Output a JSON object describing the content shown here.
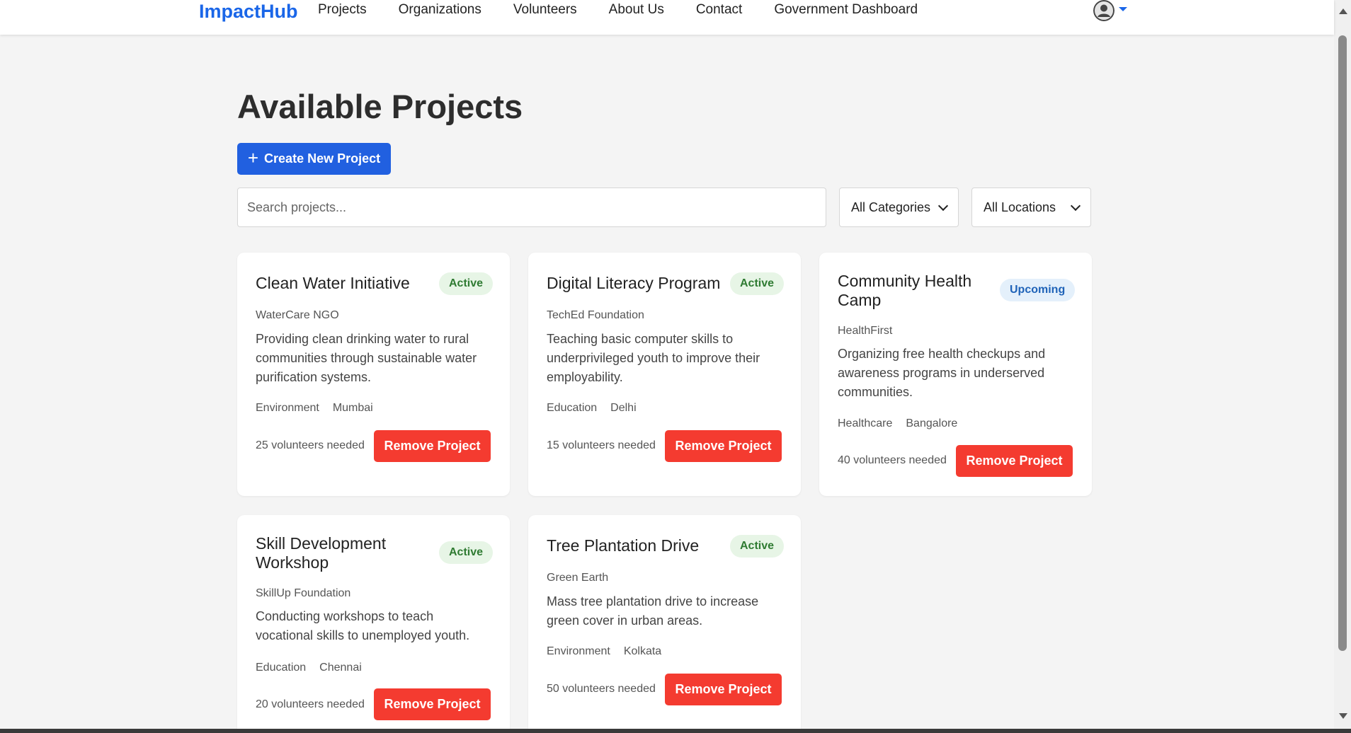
{
  "nav": {
    "brand": "ImpactHub",
    "links": [
      "Projects",
      "Organizations",
      "Volunteers",
      "About Us",
      "Contact",
      "Government Dashboard"
    ],
    "user_icon": "user-circle-icon"
  },
  "page": {
    "title": "Available Projects",
    "create_button": "Create New Project",
    "search_placeholder": "Search projects...",
    "category_filter": "All Categories",
    "location_filter": "All Locations"
  },
  "colors": {
    "brand": "#1a66e8",
    "primary_button": "#2160e0",
    "danger_button": "#f43b30",
    "active_badge_bg": "#e7f5e6",
    "upcoming_badge_bg": "#e4f0fb"
  },
  "projects": [
    {
      "title": "Clean Water Initiative",
      "status": "Active",
      "org": "WaterCare NGO",
      "description": "Providing clean drinking water to rural communities through sustainable water purification systems.",
      "category": "Environment",
      "location": "Mumbai",
      "volunteers": "25 volunteers needed",
      "action": "Remove Project"
    },
    {
      "title": "Digital Literacy Program",
      "status": "Active",
      "org": "TechEd Foundation",
      "description": "Teaching basic computer skills to underprivileged youth to improve their employability.",
      "category": "Education",
      "location": "Delhi",
      "volunteers": "15 volunteers needed",
      "action": "Remove Project"
    },
    {
      "title": "Community Health Camp",
      "status": "Upcoming",
      "org": "HealthFirst",
      "description": "Organizing free health checkups and awareness programs in underserved communities.",
      "category": "Healthcare",
      "location": "Bangalore",
      "volunteers": "40 volunteers needed",
      "action": "Remove Project"
    },
    {
      "title": "Skill Development Workshop",
      "status": "Active",
      "org": "SkillUp Foundation",
      "description": "Conducting workshops to teach vocational skills to unemployed youth.",
      "category": "Education",
      "location": "Chennai",
      "volunteers": "20 volunteers needed",
      "action": "Remove Project"
    },
    {
      "title": "Tree Plantation Drive",
      "status": "Active",
      "org": "Green Earth",
      "description": "Mass tree plantation drive to increase green cover in urban areas.",
      "category": "Environment",
      "location": "Kolkata",
      "volunteers": "50 volunteers needed",
      "action": "Remove Project"
    }
  ]
}
